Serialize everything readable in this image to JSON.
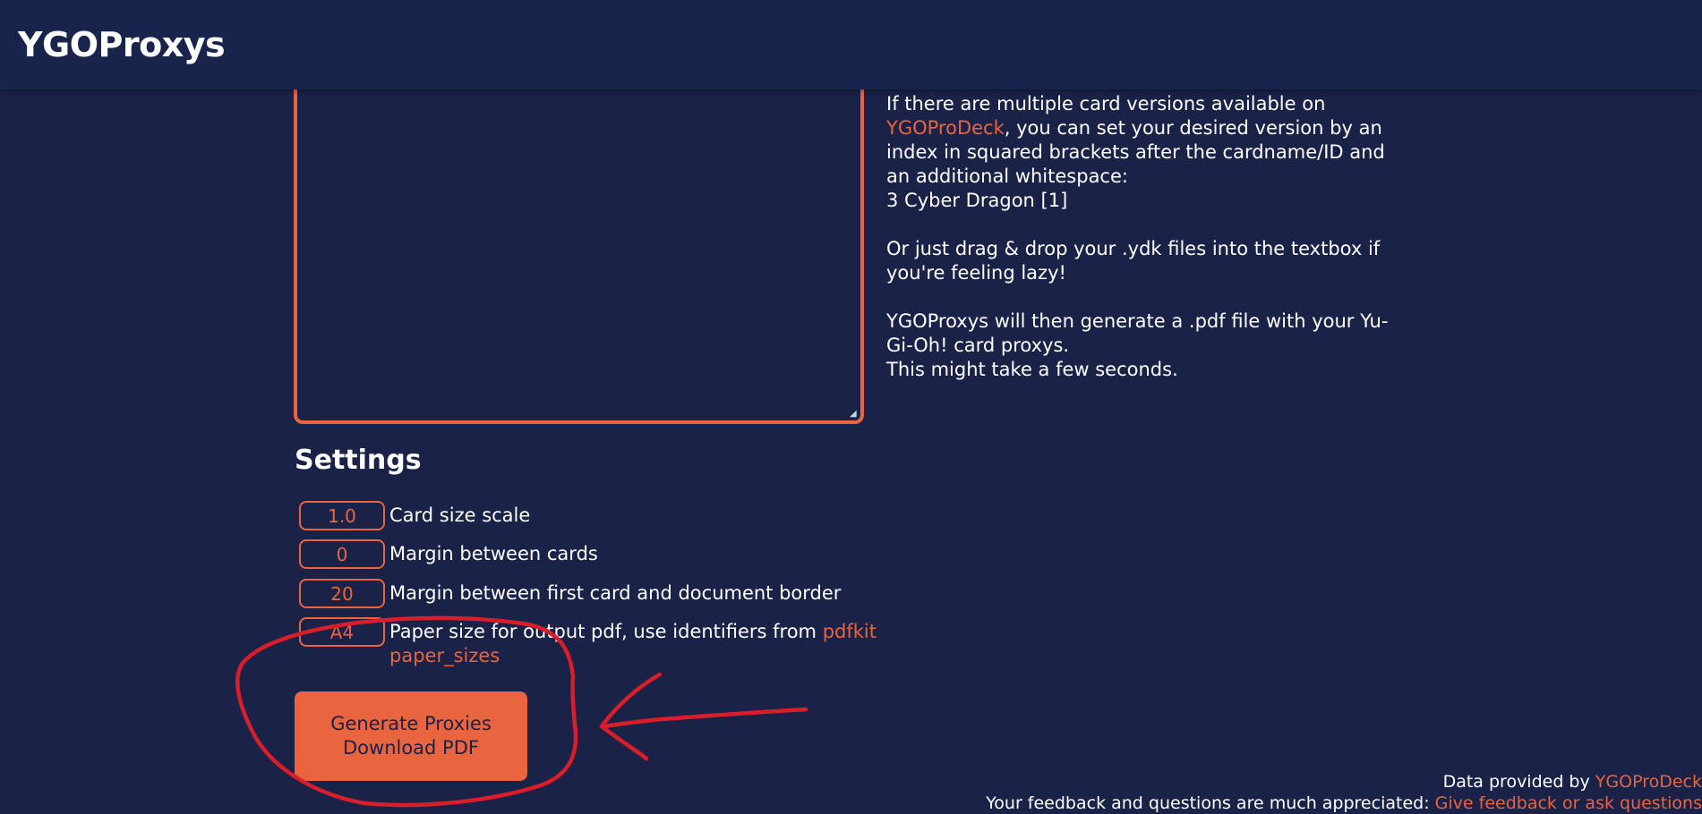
{
  "header": {
    "brand": "YGOProxys"
  },
  "help": {
    "p1_prefix": "If there are multiple card versions available on",
    "p1_link": "YGOProDeck",
    "p1_suffix": ", you can set your desired version by an index in squared brackets after the cardname/ID and an additional whitespace:",
    "p1_example": "3 Cyber Dragon [1]",
    "p2": "Or just drag & drop your .ydk files into the textbox if you're feeling lazy!",
    "p3_line1": "YGOProxys will then generate a .pdf file with your Yu-Gi-Oh! card proxys.",
    "p3_line2": "This might take a few seconds."
  },
  "settings": {
    "title": "Settings",
    "rows": [
      {
        "value": "1.0",
        "label": "Card size scale"
      },
      {
        "value": "0",
        "label": "Margin between cards"
      },
      {
        "value": "20",
        "label": "Margin between first card and document border"
      },
      {
        "value": "A4",
        "label": "Paper size for output pdf, use identifiers from",
        "link": "pdfkit paper_sizes"
      }
    ]
  },
  "button": {
    "line1": "Generate Proxies",
    "line2": "Download PDF"
  },
  "footer": {
    "line1_prefix": "Data provided by",
    "line1_link": "YGOProDeck",
    "line2_prefix": "Your feedback and questions are much appreciated:",
    "line2_link": "Give feedback or ask questions"
  },
  "colors": {
    "background": "#1a2248",
    "header": "#19244d",
    "accent": "#e8653f",
    "annotation": "#d81e2a"
  }
}
